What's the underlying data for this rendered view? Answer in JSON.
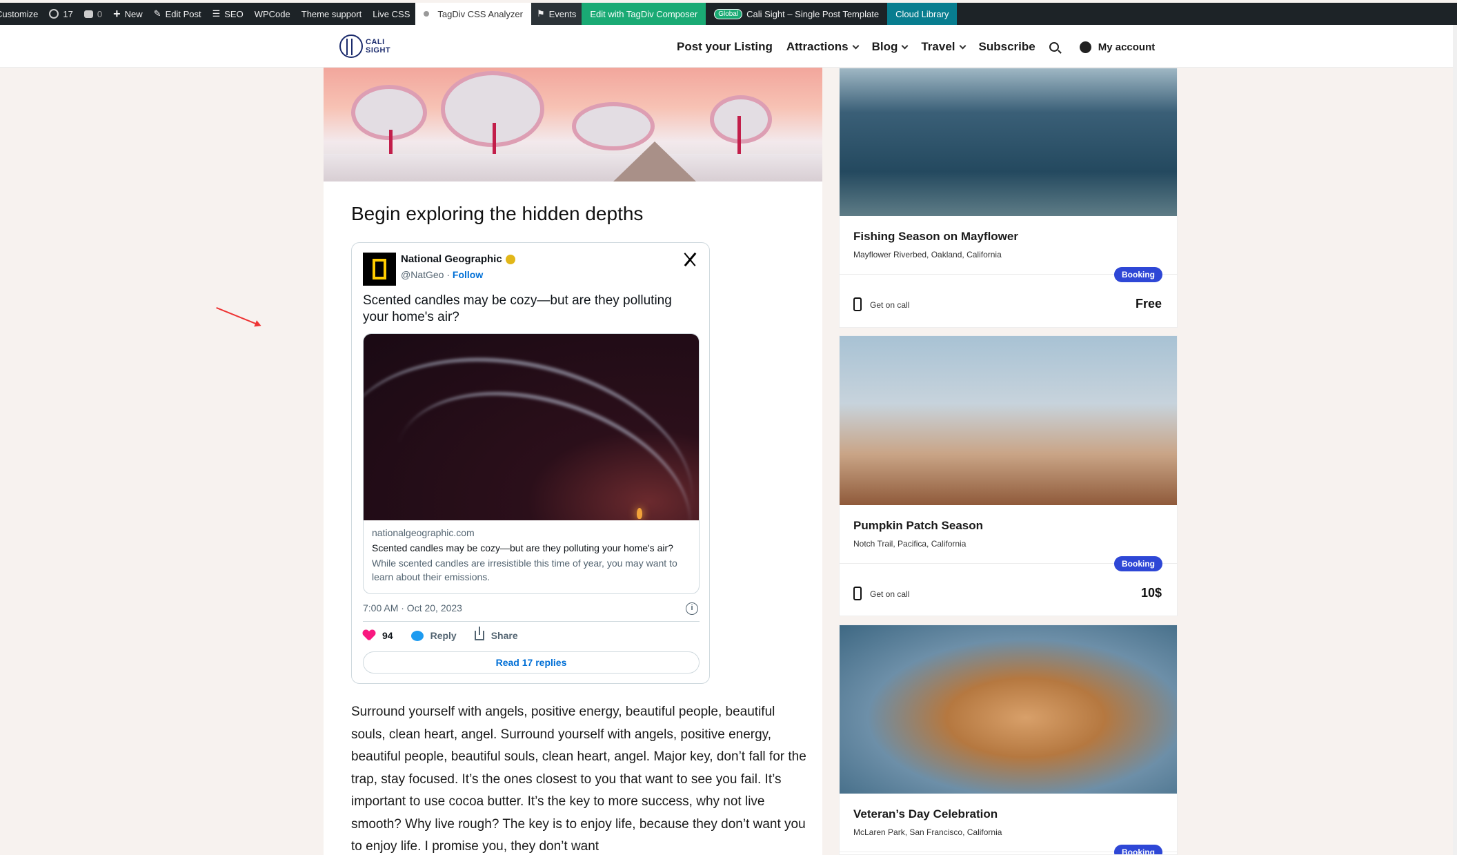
{
  "adminbar": {
    "customize": "Customize",
    "updates_count": "17",
    "comments_count": "0",
    "new": "New",
    "edit_post": "Edit Post",
    "seo": "SEO",
    "wpcode": "WPCode",
    "theme_support": "Theme support",
    "live_css": "Live CSS",
    "tagdiv_analyzer": "TagDiv CSS Analyzer",
    "events": "Events",
    "edit_composer": "Edit with TagDiv Composer",
    "global_badge": "Global",
    "template": "Cali Sight – Single Post Template",
    "cloud_library": "Cloud Library"
  },
  "header": {
    "logo_line1": "CALI",
    "logo_line2": "SIGHT",
    "nav": [
      "Post your Listing",
      "Attractions",
      "Blog",
      "Travel",
      "Subscribe"
    ],
    "account": "My account"
  },
  "post": {
    "title": "Begin exploring the hidden depths",
    "body": "Surround yourself with angels, positive energy, beautiful people, beautiful souls, clean heart, angel. Surround yourself with angels, positive energy, beautiful people, beautiful souls, clean heart, angel. Major key, don’t fall for the trap, stay focused. It’s the ones closest to you that want to see you fail. It’s important to use cocoa butter. It’s the key to more success, why not live smooth? Why live rough? The key is to enjoy life, because they don’t want you to enjoy life. I promise you, they don’t want"
  },
  "tweet": {
    "name": "National Geographic",
    "handle": "@NatGeo",
    "separator": "·",
    "follow": "Follow",
    "text": "Scented candles may be cozy—but are they polluting your home's air?",
    "card_domain": "nationalgeographic.com",
    "card_title": "Scented candles may be cozy—but are they polluting your home's air?",
    "card_desc": "While scented candles are irresistible this time of year, you may want to learn about their emissions.",
    "time": "7:00 AM · Oct 20, 2023",
    "likes": "94",
    "reply": "Reply",
    "share": "Share",
    "read_replies": "Read 17 replies"
  },
  "sidebar": {
    "cards": [
      {
        "title": "Fishing Season on Mayflower",
        "location": "Mayflower Riverbed, Oakland, California",
        "badge": "Booking",
        "call": "Get on call",
        "price": "Free"
      },
      {
        "title": "Pumpkin Patch Season",
        "location": "Notch Trail, Pacifica, California",
        "badge": "Booking",
        "call": "Get on call",
        "price": "10$"
      },
      {
        "title": "Veteran’s Day Celebration",
        "location": "McLaren Park, San Francisco, California",
        "badge": "Booking"
      }
    ]
  },
  "colors": {
    "adminbar": "#1d2327",
    "booking": "#2e47d6",
    "follow": "#006fd6",
    "like": "#f91880"
  }
}
